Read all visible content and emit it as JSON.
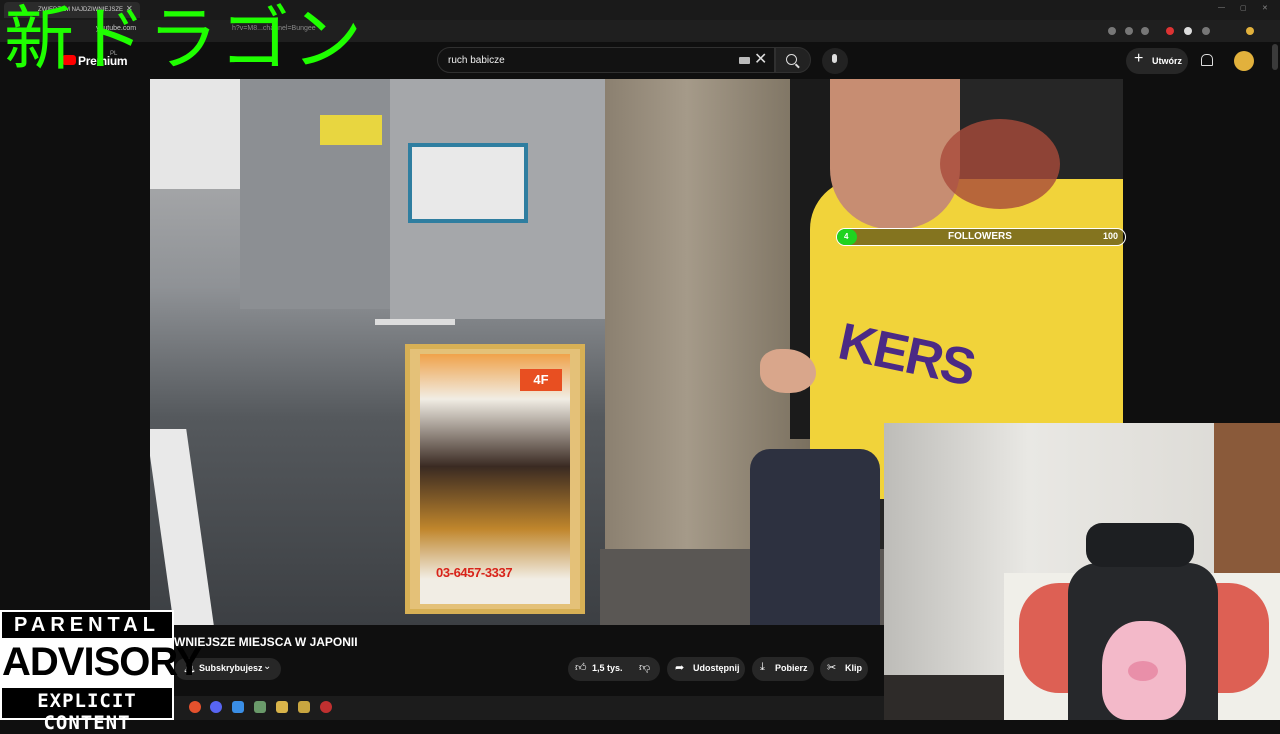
{
  "browser": {
    "tab_title": "ZWIEDZAM NAJDZIWNIEJSZE",
    "url": "youtube.com",
    "url_tail": "h?v=M8...channel=Bungee"
  },
  "header": {
    "premium_label": "Premium",
    "region": "PL",
    "search_value": "ruch babicze",
    "create_label": "Utwórz"
  },
  "overlay": {
    "dragon_text": "新ドラゴン",
    "followers": {
      "label": "FOLLOWERS",
      "current": 4,
      "goal": 100,
      "current_text": "4",
      "goal_text": "100"
    },
    "advisory": {
      "top": "PARENTAL",
      "middle": "ADVISORY",
      "bottom": "EXPLICIT CONTENT"
    }
  },
  "video": {
    "title": "WNIEJSZE MIEJSCA W JAPONII",
    "poster_badge": "4F",
    "poster_phone": "03-6457-3337",
    "jersey_text": "KERS"
  },
  "actions": {
    "subscribe_label": "Subskrybujesz",
    "likes": "1,5 tys.",
    "share": "Udostępnij",
    "download": "Pobierz",
    "clip": "Klip"
  },
  "colors": {
    "accent_green": "#1fff00",
    "youtube_red": "#ff0000",
    "followers_fill": "#1fd31f"
  }
}
